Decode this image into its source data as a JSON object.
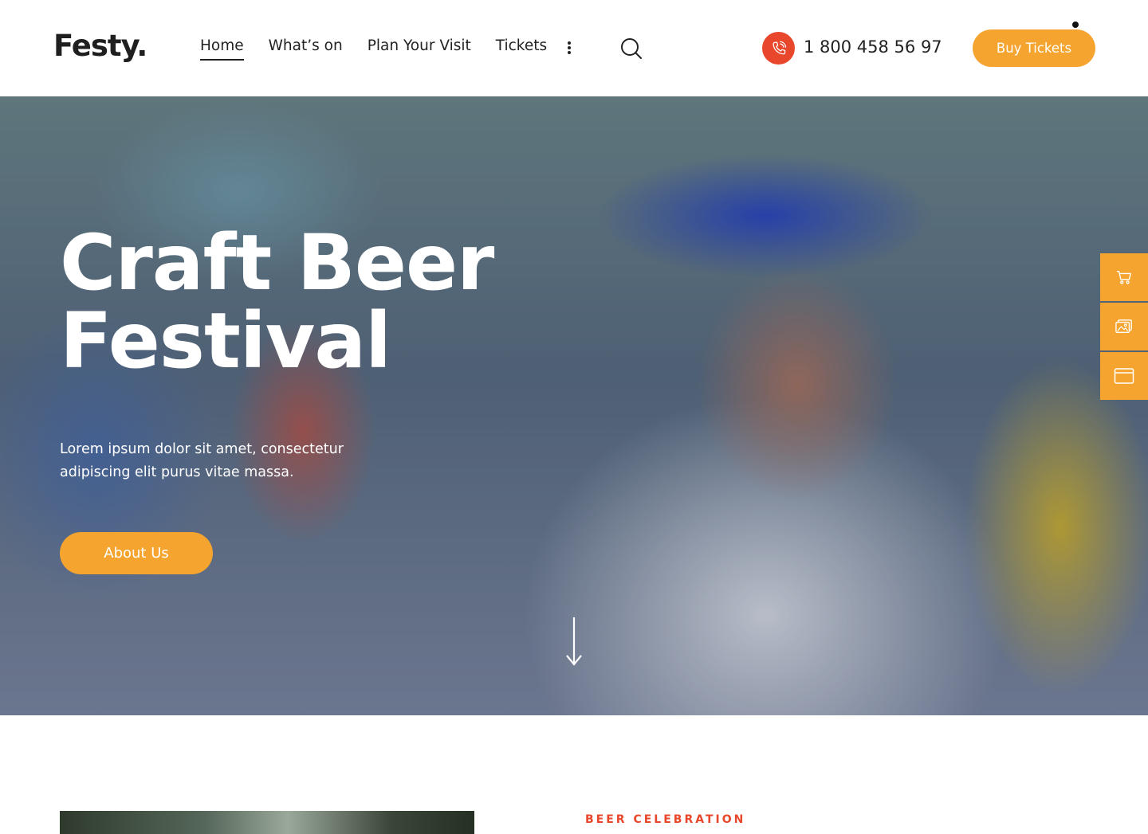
{
  "header": {
    "logo": "Festy.",
    "nav": [
      {
        "label": "Home",
        "active": true
      },
      {
        "label": "What’s on",
        "active": false
      },
      {
        "label": "Plan Your Visit",
        "active": false
      },
      {
        "label": "Tickets",
        "active": false
      }
    ],
    "more_icon": "vertical-dots-icon",
    "search_icon": "search-icon",
    "phone_icon": "phone-icon",
    "phone": "1 800 458 56 97",
    "buy_label": "Buy Tickets"
  },
  "hero": {
    "title_line1": "Craft Beer",
    "title_line2": "Festival",
    "subtitle": "Lorem ipsum dolor sit amet, consectetur adipiscing elit purus vitae massa.",
    "button_label": "About Us",
    "scroll_icon": "arrow-down-icon"
  },
  "side_toolbar": {
    "items": [
      "cart-icon",
      "image-gallery-icon",
      "browser-window-icon"
    ]
  },
  "section": {
    "eyebrow": "BEER CELEBRATION"
  },
  "colors": {
    "accent": "#f5a52f",
    "phone_badge": "#e8472b",
    "eyebrow": "#e8472b",
    "text_dark": "#222222"
  }
}
